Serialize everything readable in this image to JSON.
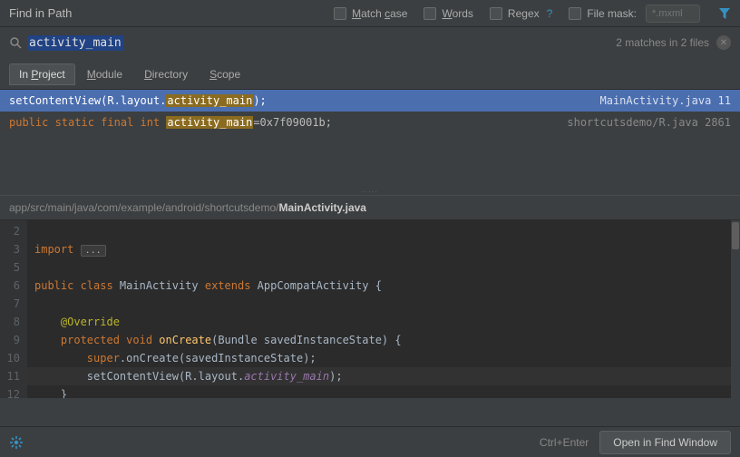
{
  "header": {
    "title": "Find in Path",
    "match_case": "Match case",
    "words": "Words",
    "regex": "Regex",
    "regex_help": "?",
    "file_mask": "File mask:",
    "file_mask_placeholder": "*.mxml"
  },
  "search": {
    "query": "activity_main",
    "status": "2 matches in 2 files"
  },
  "tabs": {
    "in_project_pre": "In ",
    "in_project_u": "P",
    "in_project_post": "roject",
    "module_u": "M",
    "module_post": "odule",
    "directory_u": "D",
    "directory_post": "irectory",
    "scope_u": "S",
    "scope_post": "cope"
  },
  "results": [
    {
      "prefix": "setContentView(R.layout.",
      "match": "activity_main",
      "suffix": ");",
      "file": "MainActivity.java",
      "line": "11",
      "selected": true,
      "keyword_prefix": false
    },
    {
      "prefix_kw": "public static final int ",
      "prefix": "",
      "match": "activity_main",
      "suffix": "=0x7f09001b;",
      "file": "shortcutsdemo/R.java",
      "line": "2861",
      "selected": false,
      "keyword_prefix": true
    }
  ],
  "path_bar": {
    "dir": "app/src/main/java/com/example/android/shortcutsdemo/",
    "file": "MainActivity.java"
  },
  "editor": {
    "lines": [
      {
        "n": "2",
        "html": ""
      },
      {
        "n": "3",
        "html": "<span class='c-kw'>import</span> <span class='c-dots'>...</span>"
      },
      {
        "n": "5",
        "html": ""
      },
      {
        "n": "6",
        "html": "<span class='c-kw'>public class</span> MainActivity <span class='c-kw'>extends</span> AppCompatActivity {"
      },
      {
        "n": "7",
        "html": ""
      },
      {
        "n": "8",
        "html": "    <span class='c-ann'>@Override</span>"
      },
      {
        "n": "9",
        "html": "    <span class='c-kw'>protected void</span> <span class='c-fn'>onCreate</span>(Bundle savedInstanceState) {"
      },
      {
        "n": "10",
        "html": "        <span class='c-kw'>super</span>.onCreate(savedInstanceState);"
      },
      {
        "n": "11",
        "html": "        setContentView(R.layout.<span class='c-italic'>activity_main</span>);",
        "hl": true
      },
      {
        "n": "12",
        "html": "    }"
      }
    ]
  },
  "footer": {
    "hint": "Ctrl+Enter",
    "button": "Open in Find Window"
  }
}
